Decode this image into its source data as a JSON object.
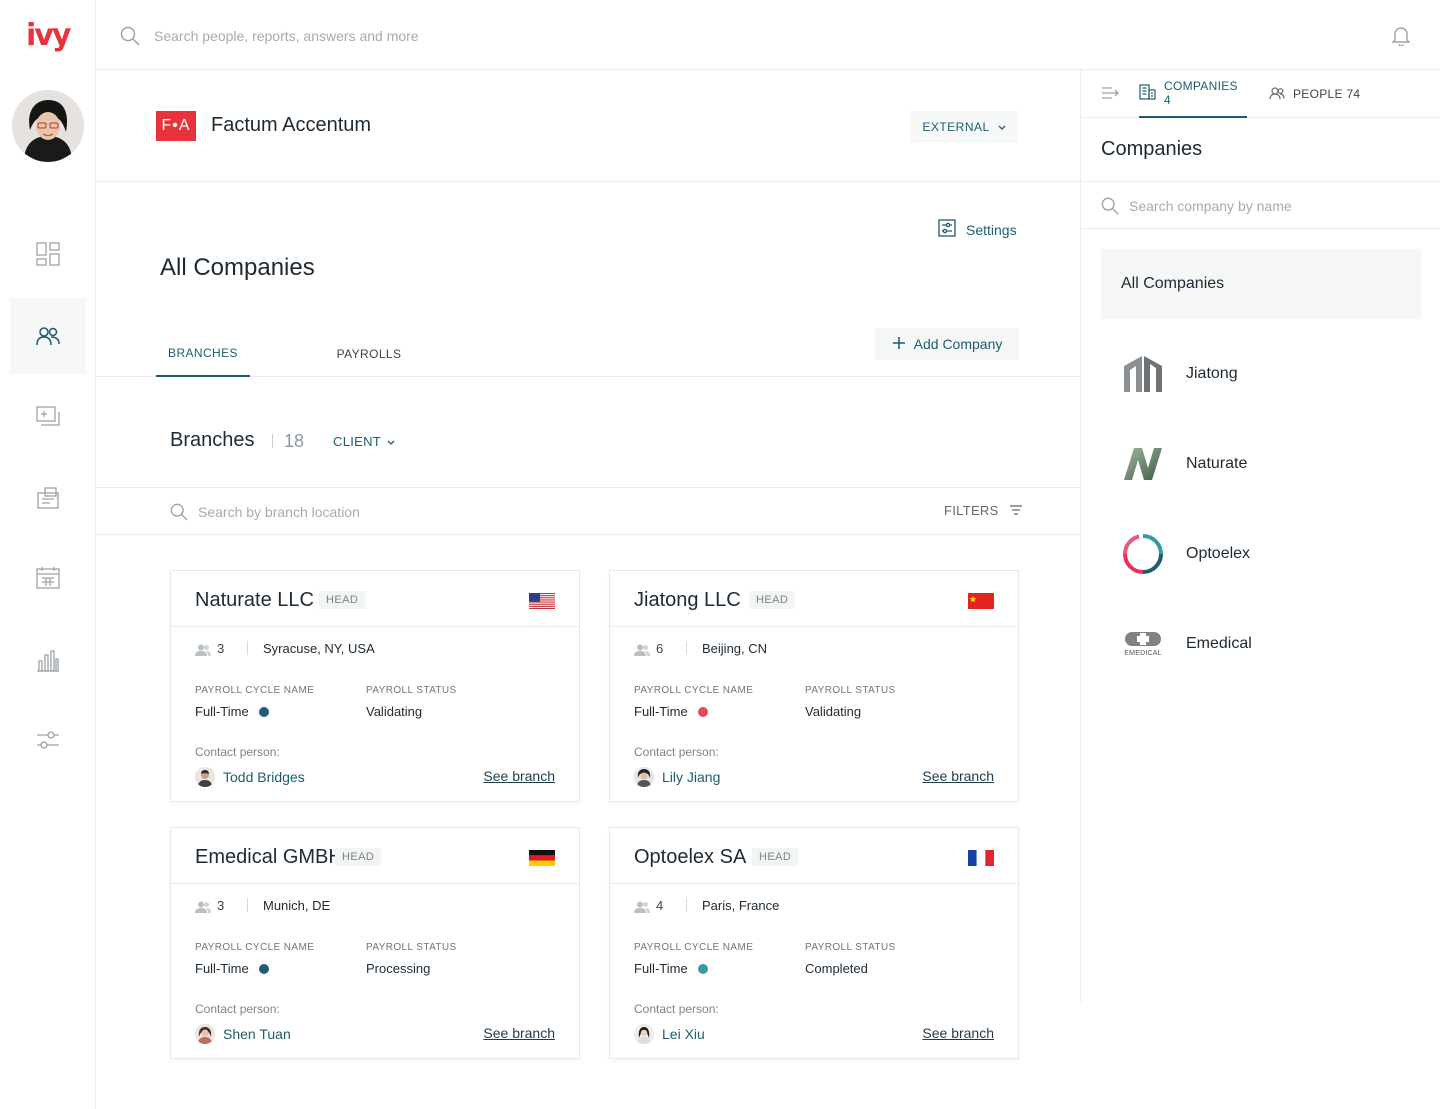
{
  "app": {
    "logo_text": "ivy"
  },
  "topbar": {
    "search_placeholder": "Search people, reports, answers and more"
  },
  "company": {
    "logo_text": "F•A",
    "name": "Factum Accentum",
    "type_button": "EXTERNAL"
  },
  "main": {
    "settings_label": "Settings",
    "title": "All Companies",
    "tabs": [
      {
        "label": "BRANCHES",
        "active": true
      },
      {
        "label": "PAYROLLS",
        "active": false
      }
    ],
    "add_company_label": "Add Company",
    "branches_title": "Branches",
    "branches_count": "18",
    "client_filter": "CLIENT",
    "branch_search_placeholder": "Search by branch location",
    "filters_label": "FILTERS"
  },
  "branches": [
    {
      "name": "Naturate LLC",
      "badge": "HEAD",
      "flag": "us",
      "people": "3",
      "location": "Syracuse, NY, USA",
      "payroll_label": "PAYROLL CYCLE NAME",
      "payroll_cycle": "Full-Time",
      "dot_color": "#1f5f73",
      "status_label": "PAYROLL STATUS",
      "status": "Validating",
      "contact_label": "Contact person:",
      "contact": "Todd Bridges",
      "link": "See branch"
    },
    {
      "name": "Jiatong LLC",
      "badge": "HEAD",
      "flag": "cn",
      "people": "6",
      "location": "Beijing, CN",
      "payroll_label": "PAYROLL CYCLE NAME",
      "payroll_cycle": "Full-Time",
      "dot_color": "#e04a5a",
      "status_label": "PAYROLL STATUS",
      "status": "Validating",
      "contact_label": "Contact person:",
      "contact": "Lily Jiang",
      "link": "See branch"
    },
    {
      "name": "Emedical GMBH",
      "badge": "HEAD",
      "flag": "de",
      "people": "3",
      "location": "Munich, DE",
      "payroll_label": "PAYROLL CYCLE NAME",
      "payroll_cycle": "Full-Time",
      "dot_color": "#1f5f73",
      "status_label": "PAYROLL STATUS",
      "status": "Processing",
      "contact_label": "Contact person:",
      "contact": "Shen Tuan",
      "link": "See branch"
    },
    {
      "name": "Optoelex SA",
      "badge": "HEAD",
      "flag": "fr",
      "people": "4",
      "location": "Paris, France",
      "payroll_label": "PAYROLL CYCLE NAME",
      "payroll_cycle": "Full-Time",
      "dot_color": "#3b9aa0",
      "status_label": "PAYROLL STATUS",
      "status": "Completed",
      "contact_label": "Contact person:",
      "contact": "Lei Xiu",
      "link": "See branch"
    }
  ],
  "panel": {
    "tab_companies": "COMPANIES 4",
    "tab_people": "PEOPLE 74",
    "title": "Companies",
    "search_placeholder": "Search company by name",
    "all_companies_label": "All Companies",
    "companies": [
      {
        "name": "Jiatong",
        "icon": "jiatong-logo"
      },
      {
        "name": "Naturate",
        "icon": "naturate-logo"
      },
      {
        "name": "Optoelex",
        "icon": "optoelex-logo"
      },
      {
        "name": "Emedical",
        "icon": "emedical-logo",
        "logo_caption": "EMEDICAL"
      }
    ]
  },
  "colors": {
    "accent": "#1d5c6e",
    "brand_red": "#e8323c"
  }
}
